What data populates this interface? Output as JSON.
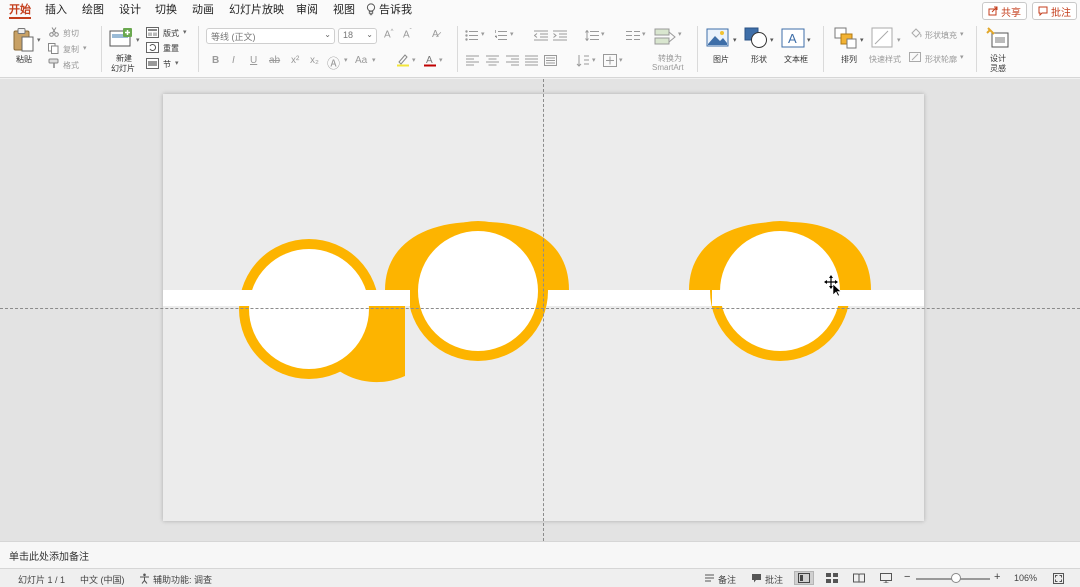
{
  "colors": {
    "accent": "#c43e1c",
    "shape": "#fdb400",
    "slide_bg": "#ececec",
    "band": "#ffffff"
  },
  "tabs": [
    {
      "label": "开始",
      "active": true
    },
    {
      "label": "插入"
    },
    {
      "label": "绘图"
    },
    {
      "label": "设计"
    },
    {
      "label": "切换"
    },
    {
      "label": "动画"
    },
    {
      "label": "幻灯片放映"
    },
    {
      "label": "审阅"
    },
    {
      "label": "视图"
    }
  ],
  "tell_me": "告诉我",
  "share_label": "共享",
  "comment_label": "批注",
  "ribbon": {
    "paste": "粘贴",
    "cut": "剪切",
    "copy": "复制",
    "format": "格式",
    "new_slide_line1": "新建",
    "new_slide_line2": "幻灯片",
    "layout": "版式",
    "reset": "重置",
    "section": "节",
    "font_name": "等线 (正文)",
    "font_size": "18",
    "convert_line1": "转换为",
    "convert_line2": "SmartArt",
    "picture": "图片",
    "shape": "形状",
    "textbox": "文本框",
    "arrange": "排列",
    "quick_styles": "快速样式",
    "shape_fill": "形状填充",
    "shape_outline": "形状轮廓",
    "designer_line1": "设计",
    "designer_line2": "灵感"
  },
  "notes_placeholder": "单击此处添加备注",
  "status": {
    "slide_indicator": "幻灯片 1 / 1",
    "language": "中文 (中国)",
    "accessibility": "辅助功能: 调查",
    "notes": "备注",
    "comments": "批注",
    "zoom": "106%"
  }
}
